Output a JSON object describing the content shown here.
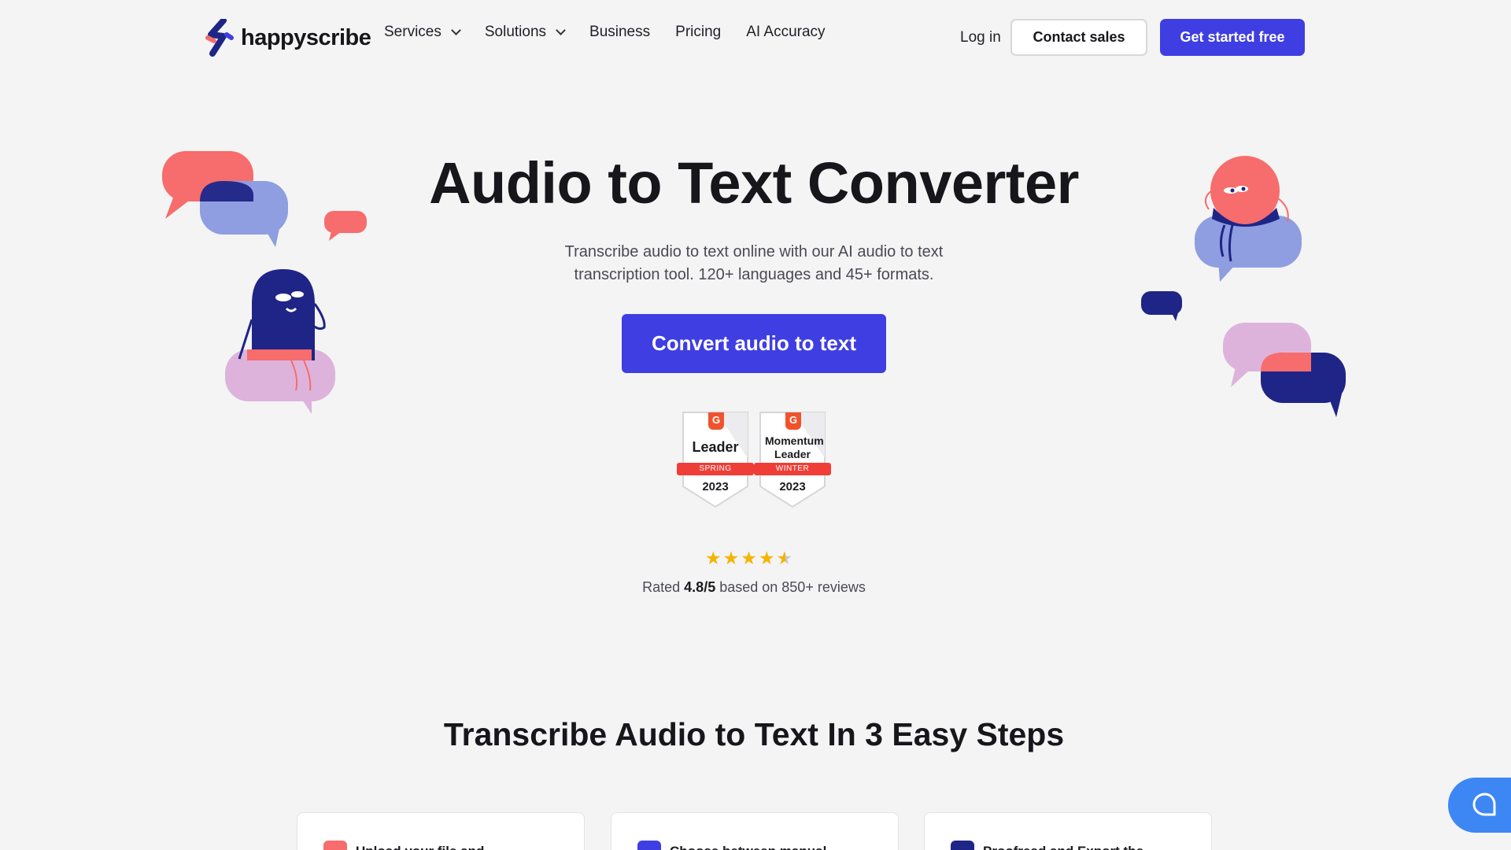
{
  "brand": {
    "name": "happyscribe"
  },
  "nav": {
    "links": [
      {
        "label": "Services",
        "dropdown": true
      },
      {
        "label": "Solutions",
        "dropdown": true
      },
      {
        "label": "Business",
        "dropdown": false
      },
      {
        "label": "Pricing",
        "dropdown": false
      },
      {
        "label": "AI Accuracy",
        "dropdown": false
      }
    ],
    "login": "Log in",
    "contact_sales": "Contact sales",
    "get_started": "Get started free"
  },
  "hero": {
    "title": "Audio to Text Converter",
    "subtitle": "Transcribe audio to text online with our AI audio to text transcription tool. 120+ languages and 45+ formats.",
    "cta": "Convert audio to text"
  },
  "badges": [
    {
      "title": "Leader",
      "ribbon": "SPRING",
      "year": "2023",
      "logo": "G"
    },
    {
      "title": "Momentum Leader",
      "ribbon": "WINTER",
      "year": "2023",
      "logo": "G"
    }
  ],
  "rating": {
    "stars": 4.5,
    "prefix": "Rated ",
    "score": "4.8/5",
    "suffix": " based on 850+ reviews"
  },
  "steps": {
    "title": "Transcribe Audio to Text In 3 Easy Steps",
    "cards": [
      {
        "label": "Upload your file and",
        "color": "#f76c6c"
      },
      {
        "label": "Choose between manual",
        "color": "#3f3ee2"
      },
      {
        "label": "Proofread and Export the",
        "color": "#1f2586"
      }
    ]
  },
  "colors": {
    "accent": "#3f3ee2",
    "coral": "#f76c6c",
    "navy": "#1f2586",
    "periwinkle": "#8e9ee0",
    "lilac": "#ddb3dc",
    "chat": "#3d87f5"
  },
  "icons": [
    "logo-icon",
    "chevron-down-icon",
    "star-icon",
    "chat-icon"
  ]
}
